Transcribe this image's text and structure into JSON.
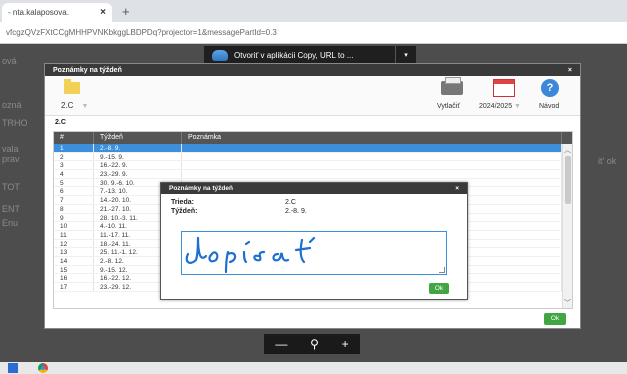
{
  "browser": {
    "tab_title": "- nta.kalaposova.",
    "tab_close": "×",
    "new_tab": "+",
    "url": "vfcgzQVzFXtCCgMHHPVNKbkggLBDPDq?projector=1&messagePartId=0.3"
  },
  "overlay": {
    "open_label": "Otvoriť v aplikácii Copy, URL to ...",
    "open_dropdown": "▾"
  },
  "background_fragments": [
    "ová",
    "ozná",
    "TRHO",
    "vala",
    "prav",
    "TOT",
    "ENT",
    "Enu",
    "it' ok"
  ],
  "main_dialog": {
    "title": "Poznámky na týždeň",
    "close": "×",
    "class_value": "2.C",
    "print_label": "Vytlačiť",
    "year_label": "2024/2025",
    "help_label": "Návod",
    "help_glyph": "?",
    "section_label": "2.C",
    "columns": [
      "#",
      "Týždeň",
      "Poznámka"
    ],
    "rows": [
      {
        "n": "1",
        "w": "2.-8. 9."
      },
      {
        "n": "2",
        "w": "9.-15. 9."
      },
      {
        "n": "3",
        "w": "16.-22. 9."
      },
      {
        "n": "4",
        "w": "23.-29. 9."
      },
      {
        "n": "5",
        "w": "30. 9.-6. 10."
      },
      {
        "n": "6",
        "w": "7.-13. 10."
      },
      {
        "n": "7",
        "w": "14.-20. 10."
      },
      {
        "n": "8",
        "w": "21.-27. 10."
      },
      {
        "n": "9",
        "w": "28. 10.-3. 11."
      },
      {
        "n": "10",
        "w": "4.-10. 11."
      },
      {
        "n": "11",
        "w": "11.-17. 11."
      },
      {
        "n": "12",
        "w": "18.-24. 11."
      },
      {
        "n": "13",
        "w": "25. 11.-1. 12."
      },
      {
        "n": "14",
        "w": "2.-8. 12."
      },
      {
        "n": "15",
        "w": "9.-15. 12."
      },
      {
        "n": "16",
        "w": "16.-22. 12."
      },
      {
        "n": "17",
        "w": "23.-29. 12."
      }
    ],
    "ok_label": "Ok"
  },
  "inner_dialog": {
    "title": "Poznámky na týždeň",
    "close": "×",
    "class_label": "Trieda:",
    "class_value": "2.C",
    "week_label": "Týždeň:",
    "week_value": "2.-8. 9.",
    "handwriting": "dopísať",
    "ink_color": "#1e6fd0",
    "ok_label": "Ok"
  },
  "zoom": {
    "minus": "—",
    "magnifier": "⚲",
    "plus": "+"
  },
  "colors": {
    "accent": "#3c8fda",
    "ok": "#41a642",
    "header": "#3a3a3a"
  }
}
